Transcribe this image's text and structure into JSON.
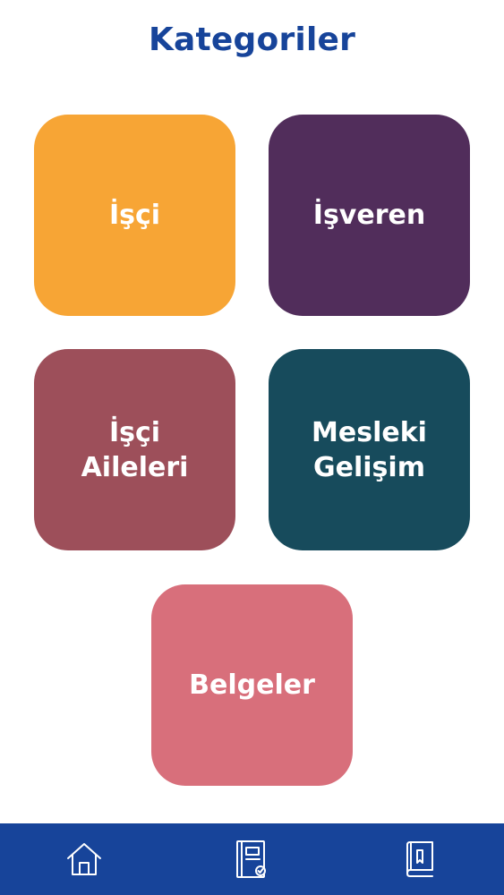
{
  "header": {
    "title": "Kategoriler"
  },
  "categories": [
    {
      "line1": "İşçi",
      "line2": "",
      "color": "#f7a535"
    },
    {
      "line1": "İşveren",
      "line2": "",
      "color": "#512d5b"
    },
    {
      "line1": "İşçi",
      "line2": "Aileleri",
      "color": "#9d4f5a"
    },
    {
      "line1": "Mesleki",
      "line2": "Gelişim",
      "color": "#174b5c"
    },
    {
      "line1": "Belgeler",
      "line2": "",
      "color": "#d86f7b"
    }
  ],
  "bottom_nav": {
    "background": "#17449a",
    "items": [
      {
        "icon": "home-icon"
      },
      {
        "icon": "document-check-icon"
      },
      {
        "icon": "book-icon"
      }
    ]
  },
  "colors": {
    "title": "#17449a",
    "icon_stroke": "#ffffff"
  }
}
